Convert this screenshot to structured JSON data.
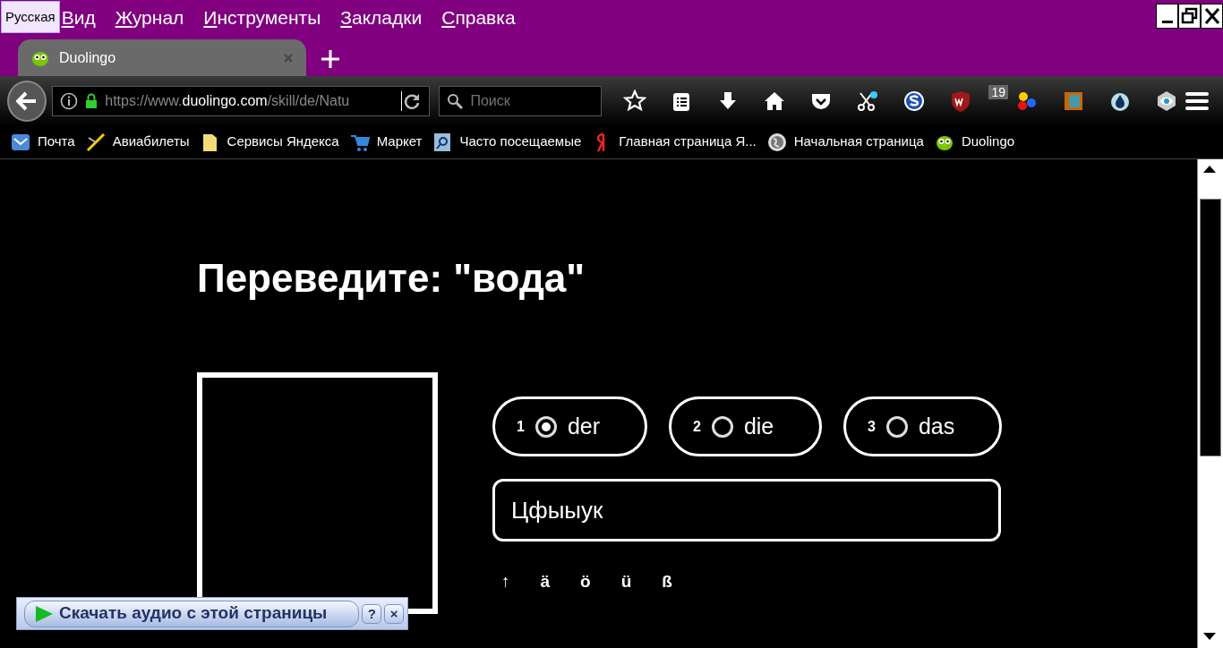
{
  "tooltip": {
    "text": "Русская"
  },
  "menu": [
    {
      "label": "Вид"
    },
    {
      "label": "Журнал"
    },
    {
      "label": "Инструменты"
    },
    {
      "label": "Закладки"
    },
    {
      "label": "Справка"
    }
  ],
  "tabs": [
    {
      "label": "Duolingo",
      "selected": true
    }
  ],
  "address_bar": {
    "host_prefix": "https://www.",
    "host": "duolingo.com",
    "path": "/skill/de/Natu"
  },
  "search": {
    "placeholder": "Поиск"
  },
  "toolbar_badge": "19",
  "bookmarks": [
    {
      "label": "Почта"
    },
    {
      "label": "Авиабилеты"
    },
    {
      "label": "Сервисы Яндекса"
    },
    {
      "label": "Маркет"
    },
    {
      "label": "Часто посещаемые"
    },
    {
      "label": "Главная страница Я..."
    },
    {
      "label": "Начальная страница"
    },
    {
      "label": "Duolingo"
    }
  ],
  "page": {
    "title": "Переведите: \"вода\"",
    "choices": [
      {
        "number": "1",
        "label": "der",
        "selected": true
      },
      {
        "number": "2",
        "label": "die",
        "selected": false
      },
      {
        "number": "3",
        "label": "das",
        "selected": false
      }
    ],
    "answer": {
      "value": "Цфыыук"
    },
    "special_keys": [
      "↑",
      "ä",
      "ö",
      "ü",
      "ß"
    ]
  },
  "audio_bar": {
    "label": "Скачать аудио с этой страницы",
    "help": "?",
    "close": "×"
  }
}
